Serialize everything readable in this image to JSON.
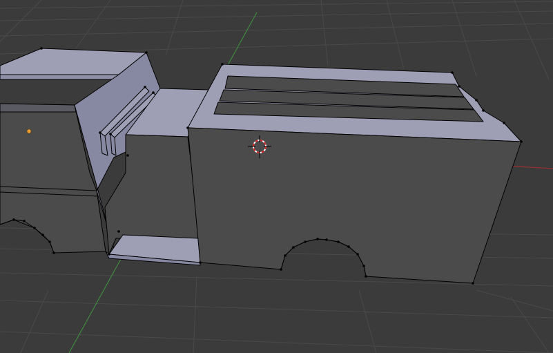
{
  "viewport": {
    "editor": "3D View",
    "background_color": "#3b3b3b",
    "grid_color": "#4a4a4a",
    "x_axis_color": "#9a3030",
    "y_axis_color": "#3f8a3f",
    "mesh_top_color": "#9e9fb5",
    "mesh_side_color": "#8788a1",
    "mesh_front_color": "#4a4a4a",
    "edge_color": "#000000",
    "vertex_color": "#000000",
    "origin_color": "#f0a030",
    "cursor": "3d-cursor-icon"
  }
}
